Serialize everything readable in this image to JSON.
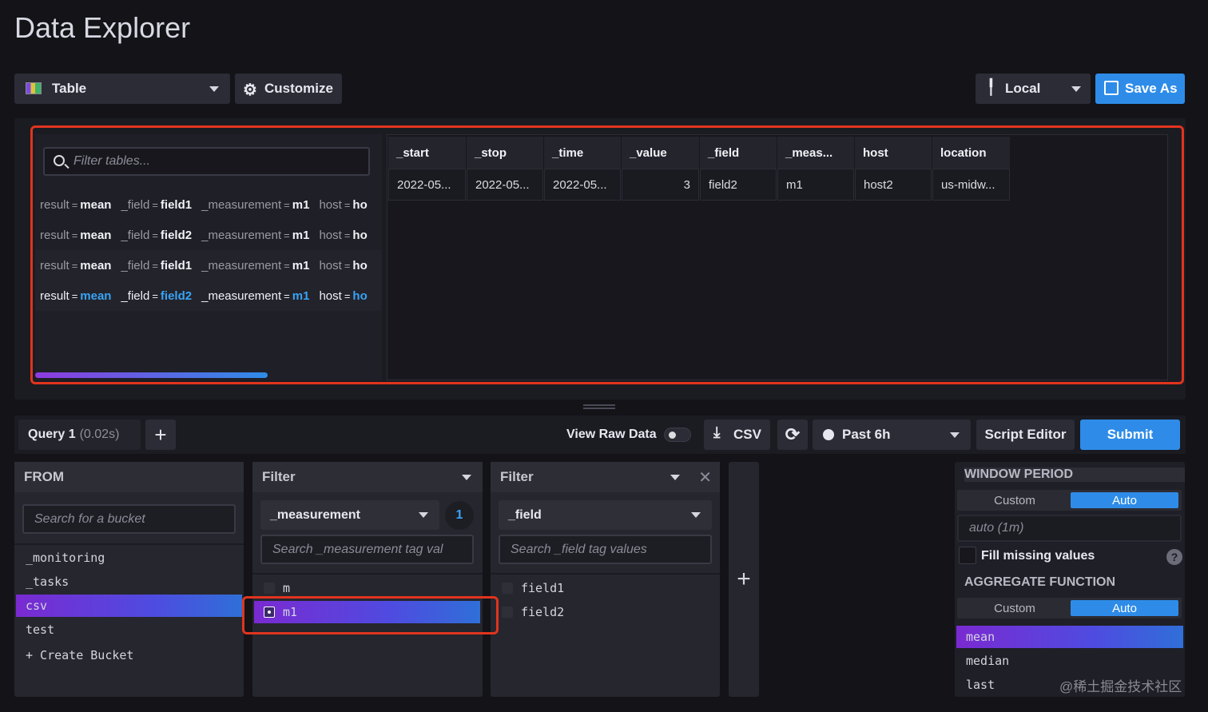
{
  "page": {
    "title": "Data Explorer"
  },
  "toolbar": {
    "view_type": "Table",
    "customize_label": "Customize",
    "timezone": "Local",
    "save_as_label": "Save As"
  },
  "tables_panel": {
    "filter_placeholder": "Filter tables...",
    "rows": [
      {
        "result": "mean",
        "field": "field1",
        "measurement": "m1",
        "host": "ho"
      },
      {
        "result": "mean",
        "field": "field2",
        "measurement": "m1",
        "host": "ho"
      },
      {
        "result": "mean",
        "field": "field1",
        "measurement": "m1",
        "host": "ho"
      },
      {
        "result": "mean",
        "field": "field2",
        "measurement": "m1",
        "host": "ho"
      }
    ],
    "keys": {
      "result": "result",
      "field": "_field",
      "measurement": "_measurement",
      "host": "host",
      "eq": "="
    }
  },
  "grid": {
    "headers": [
      "_start",
      "_stop",
      "_time",
      "_value",
      "_field",
      "_meas...",
      "host",
      "location"
    ],
    "row": [
      "2022-05...",
      "2022-05...",
      "2022-05...",
      "3",
      "field2",
      "m1",
      "host2",
      "us-midw..."
    ]
  },
  "query_bar": {
    "query_name": "Query 1",
    "query_time": "(0.02s)",
    "view_raw_label": "View Raw Data",
    "csv_label": "CSV",
    "time_range": "Past 6h",
    "script_editor_label": "Script Editor",
    "submit_label": "Submit"
  },
  "from_card": {
    "title": "FROM",
    "search_placeholder": "Search for a bucket",
    "buckets": [
      "_monitoring",
      "_tasks",
      "csv",
      "test"
    ],
    "selected": "csv",
    "create_label": "+ Create Bucket"
  },
  "filter1": {
    "title": "Filter",
    "key": "_measurement",
    "count": "1",
    "search_placeholder": "Search _measurement tag val",
    "values": [
      "m",
      "m1"
    ],
    "selected": "m1"
  },
  "filter2": {
    "title": "Filter",
    "key": "_field",
    "search_placeholder": "Search _field tag values",
    "values": [
      "field1",
      "field2"
    ]
  },
  "aggregate": {
    "window_title": "WINDOW PERIOD",
    "custom_label": "Custom",
    "auto_label": "Auto",
    "window_value": "auto (1m)",
    "fill_missing_label": "Fill missing values",
    "help": "?",
    "function_title": "AGGREGATE FUNCTION",
    "functions": [
      "mean",
      "median",
      "last"
    ],
    "selected": "mean"
  },
  "watermark": "@稀土掘金技术社区",
  "colors": {
    "accent": "#2e8ce8",
    "highlight": "#e1341e",
    "selected_gradient_start": "#7a2ad1"
  }
}
